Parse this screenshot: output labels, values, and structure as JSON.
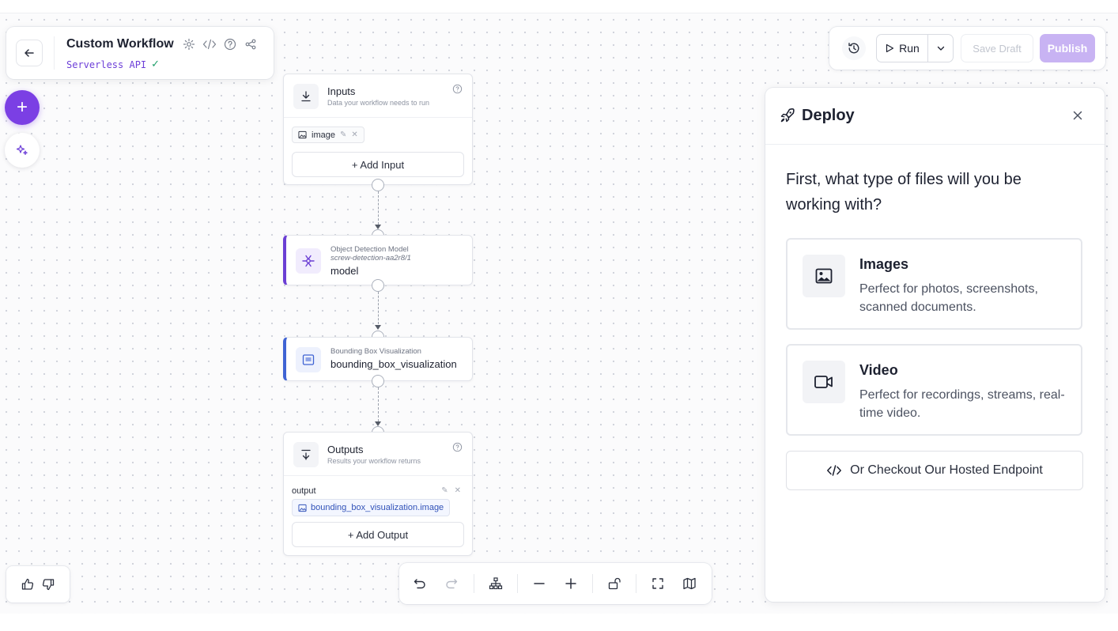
{
  "workflow": {
    "title": "Custom Workflow",
    "subtitle": "Serverless API"
  },
  "toolbar": {
    "run_label": "Run",
    "save_draft_label": "Save Draft",
    "publish_label": "Publish"
  },
  "inputs_node": {
    "title": "Inputs",
    "subtitle": "Data your workflow needs to run",
    "input_chip": "image",
    "add_label": "+ Add Input"
  },
  "model_node": {
    "kind": "Object Detection Model",
    "model_ref": "screw-detection-aa2r8/1",
    "name": "model"
  },
  "bbox_node": {
    "kind": "Bounding Box Visualization",
    "name": "bounding_box_visualization"
  },
  "outputs_node": {
    "title": "Outputs",
    "subtitle": "Results your workflow returns",
    "output_name": "output",
    "output_value": "bounding_box_visualization.image",
    "add_label": "+ Add Output"
  },
  "deploy": {
    "title": "Deploy",
    "question": "First, what type of files will you be working with?",
    "options": [
      {
        "title": "Images",
        "description": "Perfect for photos, screenshots, scanned documents.",
        "icon": "image-icon"
      },
      {
        "title": "Video",
        "description": "Perfect for recordings, streams, real-time video.",
        "icon": "video-icon"
      }
    ],
    "hosted_label": "Or Checkout Our Hosted Endpoint"
  },
  "colors": {
    "accent": "#7b3fe4",
    "publish_disabled": "#c8b3f3",
    "model_bar": "#6b3fd4",
    "viz_bar": "#3f63d4"
  }
}
